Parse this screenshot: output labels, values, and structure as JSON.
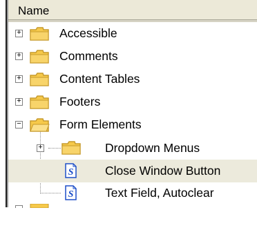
{
  "header": {
    "column_name": "Name"
  },
  "tree": {
    "items": [
      {
        "label": "Accessible",
        "toggle": "+",
        "icon": "folder-icon"
      },
      {
        "label": "Comments",
        "toggle": "+",
        "icon": "folder-icon"
      },
      {
        "label": "Content Tables",
        "toggle": "+",
        "icon": "folder-icon"
      },
      {
        "label": "Footers",
        "toggle": "+",
        "icon": "folder-icon"
      },
      {
        "label": "Form Elements",
        "toggle": "−",
        "icon": "open-folder-icon",
        "children": [
          {
            "label": "Dropdown Menus",
            "toggle": "+",
            "icon": "folder-icon"
          },
          {
            "label": "Close Window Button",
            "icon": "script-file-icon",
            "selected": true
          },
          {
            "label": "Text Field, Autoclear",
            "icon": "script-file-icon"
          }
        ]
      }
    ]
  },
  "colors": {
    "folder": "#f6c94a",
    "folder_outline": "#c69a2c",
    "selected_row": "#eceadc",
    "header_bg": "#ece9d8",
    "file_blue": "#1d4fc8"
  }
}
